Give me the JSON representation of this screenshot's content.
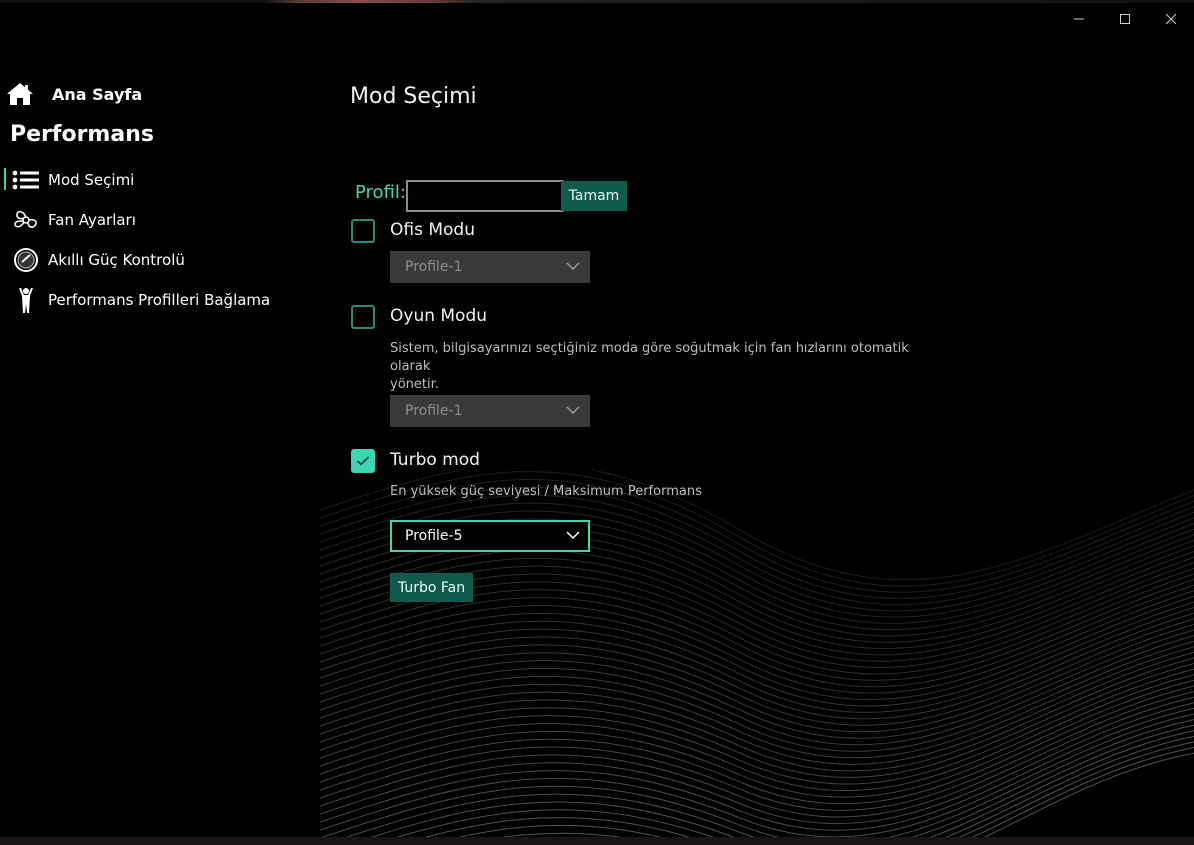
{
  "window": {
    "controls": {
      "minimize": "—",
      "maximize": "☐",
      "close": "✕"
    }
  },
  "sidebar": {
    "home_label": "Ana Sayfa",
    "section_title": "Performans",
    "items": [
      {
        "label": "Mod Seçimi",
        "icon": "list-icon",
        "active": true
      },
      {
        "label": "Fan Ayarları",
        "icon": "fan-icon",
        "active": false
      },
      {
        "label": "Akıllı Güç Kontrolü",
        "icon": "gauge-icon",
        "active": false
      },
      {
        "label": "Performans Profilleri Bağlama",
        "icon": "person-icon",
        "active": false
      }
    ]
  },
  "main": {
    "title": "Mod Seçimi",
    "profile": {
      "label": "Profil:",
      "value": "",
      "confirm_label": "Tamam"
    },
    "modes": [
      {
        "label": "Ofis Modu",
        "checked": false,
        "description": "",
        "selected_profile": "Profile-1",
        "enabled": false
      },
      {
        "label": "Oyun Modu",
        "checked": false,
        "description_line1": "Sistem, bilgisayarınızı seçtiğiniz moda göre soğutmak için fan hızlarını otomatik olarak",
        "description_line2": "yönetir.",
        "selected_profile": "Profile-1",
        "enabled": false
      },
      {
        "label": "Turbo mod",
        "checked": true,
        "description": "En yüksek güç seviyesi / Maksimum Performans",
        "selected_profile": "Profile-5",
        "enabled": true
      }
    ],
    "turbo_fan_label": "Turbo Fan"
  },
  "colors": {
    "accent": "#3dd6b5",
    "button_bg": "#0f5a4c",
    "background": "#000000",
    "disabled_select_bg": "#3a3a3a"
  }
}
